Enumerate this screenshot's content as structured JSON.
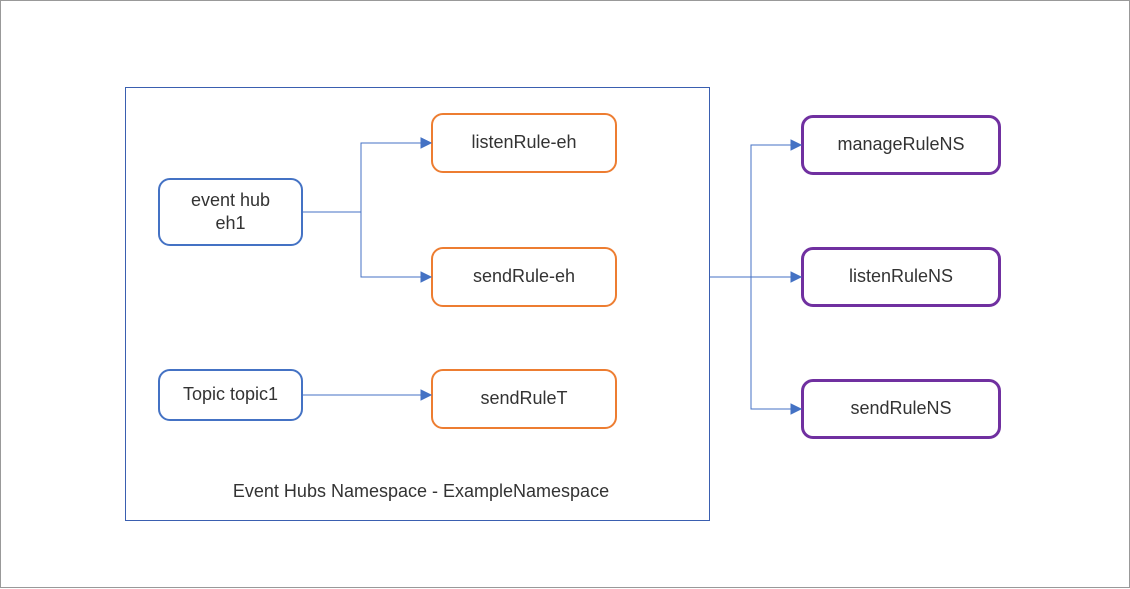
{
  "namespace": {
    "label": "Event Hubs Namespace - ExampleNamespace"
  },
  "entities": {
    "eventhub": "event hub\neh1",
    "topic": "Topic topic1"
  },
  "hubRules": {
    "listen": "listenRule-eh",
    "send": "sendRule-eh",
    "topicSend": "sendRuleT"
  },
  "nsRules": {
    "manage": "manageRuleNS",
    "listen": "listenRuleNS",
    "send": "sendRuleNS"
  }
}
